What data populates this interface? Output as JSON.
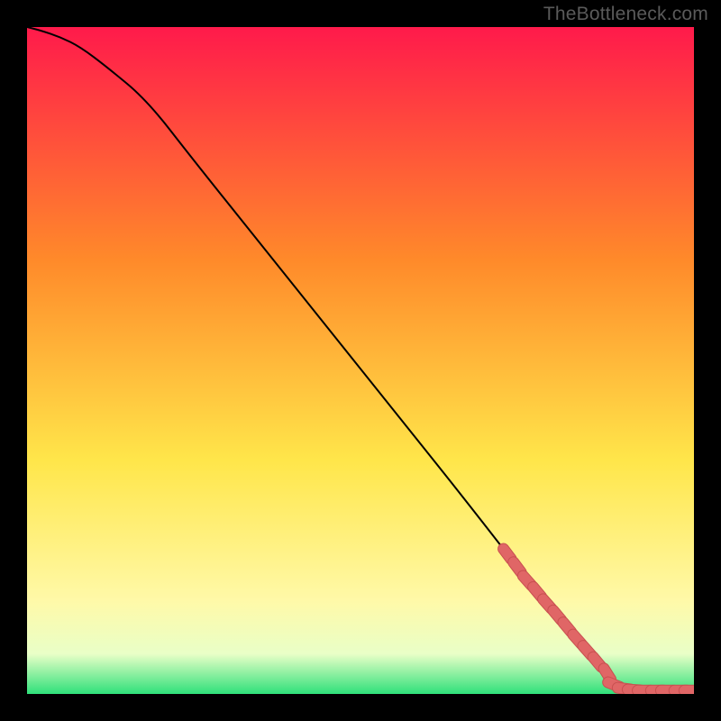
{
  "watermark": "TheBottleneck.com",
  "colors": {
    "frame": "#000000",
    "curve": "#000000",
    "marker_fill": "#e06666",
    "marker_stroke": "#c85050",
    "grad_top": "#ff1a4b",
    "grad_mid1": "#ff8a2a",
    "grad_mid2": "#ffe64a",
    "grad_mid3": "#fff9a8",
    "grad_mid4": "#e9ffc7",
    "grad_bottom": "#2fe07a"
  },
  "chart_data": {
    "type": "line",
    "title": "",
    "xlabel": "",
    "ylabel": "",
    "xlim": [
      0,
      100
    ],
    "ylim": [
      0,
      100
    ],
    "series": [
      {
        "name": "curve",
        "x": [
          0,
          2,
          5,
          8,
          12,
          18,
          25,
          35,
          45,
          55,
          65,
          72,
          76,
          80,
          84,
          86,
          88,
          92,
          96,
          100
        ],
        "y": [
          100,
          99.5,
          98.5,
          97,
          94,
          89,
          80,
          67.5,
          55,
          42.5,
          30,
          21,
          16,
          11,
          6,
          3.5,
          1.2,
          0.5,
          0.4,
          0.4
        ]
      }
    ],
    "markers": {
      "name": "highlighted-segment",
      "x": [
        72,
        73.5,
        75,
        76.5,
        78,
        79.5,
        81,
        82.5,
        84,
        85.5,
        87,
        88,
        89.5,
        91,
        92.5,
        94.5,
        96,
        98,
        99.5
      ],
      "y": [
        21,
        19,
        17,
        15.3,
        13.5,
        11.8,
        10,
        8.2,
        6.5,
        4.8,
        3,
        1.4,
        0.8,
        0.6,
        0.5,
        0.5,
        0.5,
        0.5,
        0.5
      ]
    }
  }
}
